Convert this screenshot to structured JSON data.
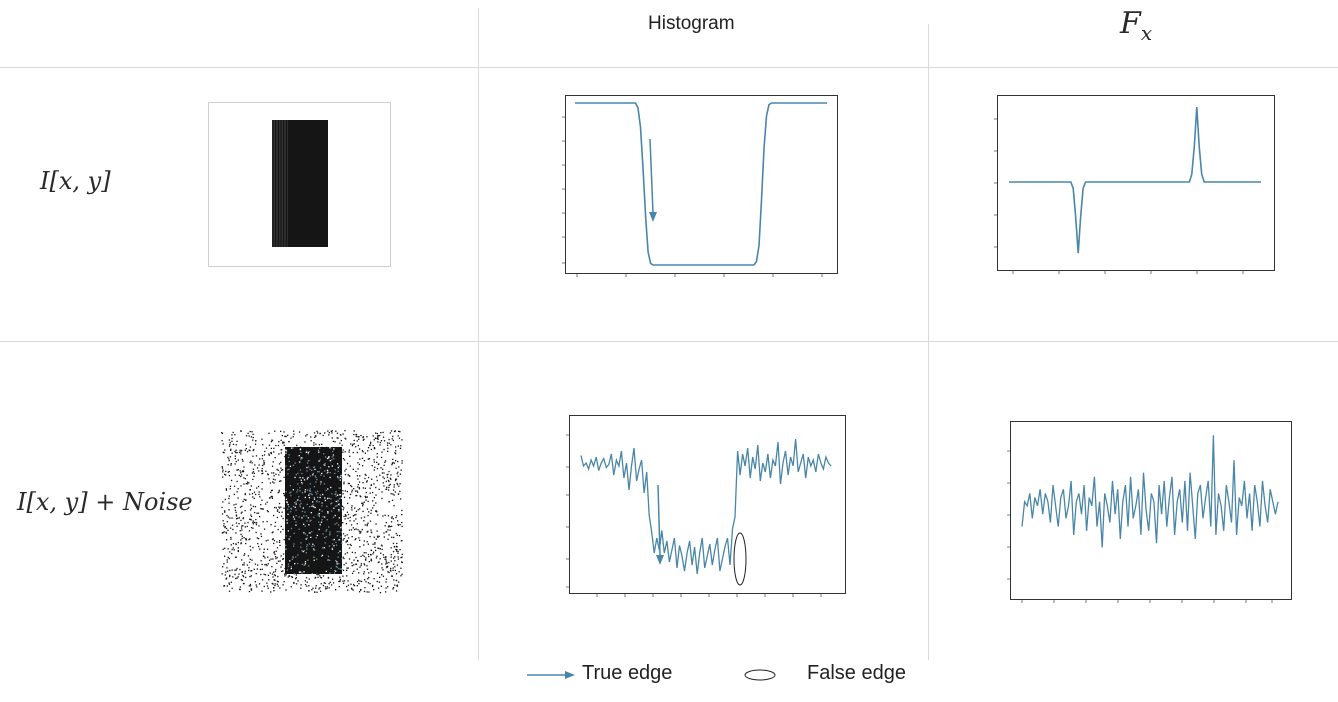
{
  "headers": {
    "histogram": "Histogram",
    "fx_main": "F",
    "fx_sub": "x"
  },
  "rows": [
    {
      "label_main": "I[x, y]",
      "label_suffix": ""
    },
    {
      "label_main": "I[x, y] + ",
      "label_suffix": "Noise"
    }
  ],
  "legend": {
    "true_edge": "True edge",
    "false_edge": "False edge"
  },
  "colors": {
    "line": "#4a86a8",
    "grid_line": "#d9d9d9",
    "axis": "#333333",
    "image_fill": "#151515"
  },
  "chart_data": [
    {
      "type": "line",
      "xlim": [
        0,
        100
      ],
      "ylim": [
        0,
        1
      ],
      "series": [
        {
          "values": [
            1,
            1,
            1,
            1,
            1,
            1,
            1,
            1,
            1,
            1,
            1,
            1,
            1,
            1,
            1,
            1,
            1,
            1,
            1,
            1,
            1,
            1,
            1,
            1,
            1,
            0.97,
            0.85,
            0.6,
            0.3,
            0.08,
            0.01,
            0,
            0,
            0,
            0,
            0,
            0,
            0,
            0,
            0,
            0,
            0,
            0,
            0,
            0,
            0,
            0,
            0,
            0,
            0,
            0,
            0,
            0,
            0,
            0,
            0,
            0,
            0,
            0,
            0,
            0,
            0,
            0,
            0,
            0,
            0,
            0,
            0,
            0,
            0,
            0,
            0,
            0.02,
            0.12,
            0.4,
            0.72,
            0.92,
            0.99,
            1,
            1,
            1,
            1,
            1,
            1,
            1,
            1,
            1,
            1,
            1,
            1,
            1,
            1,
            1,
            1,
            1,
            1,
            1,
            1,
            1,
            1,
            1
          ]
        }
      ]
    },
    {
      "type": "line",
      "xlim": [
        0,
        100
      ],
      "ylim": [
        -1,
        1
      ],
      "series": [
        {
          "values": [
            0,
            0,
            0,
            0,
            0,
            0,
            0,
            0,
            0,
            0,
            0,
            0,
            0,
            0,
            0,
            0,
            0,
            0,
            0,
            0,
            0,
            0,
            0,
            0,
            0,
            0,
            -0.08,
            -0.45,
            -0.9,
            -0.45,
            -0.08,
            0,
            0,
            0,
            0,
            0,
            0,
            0,
            0,
            0,
            0,
            0,
            0,
            0,
            0,
            0,
            0,
            0,
            0,
            0,
            0,
            0,
            0,
            0,
            0,
            0,
            0,
            0,
            0,
            0,
            0,
            0,
            0,
            0,
            0,
            0,
            0,
            0,
            0,
            0,
            0,
            0,
            0,
            0,
            0.1,
            0.45,
            0.95,
            0.45,
            0.1,
            0,
            0,
            0,
            0,
            0,
            0,
            0,
            0,
            0,
            0,
            0,
            0,
            0,
            0,
            0,
            0,
            0,
            0,
            0,
            0,
            0,
            0,
            0,
            0
          ]
        }
      ]
    },
    {
      "type": "line",
      "xlim": [
        0,
        100
      ],
      "ylim": [
        0,
        1
      ],
      "series": [
        {
          "values": [
            0.85,
            0.78,
            0.8,
            0.76,
            0.82,
            0.78,
            0.84,
            0.75,
            0.8,
            0.83,
            0.77,
            0.79,
            0.86,
            0.72,
            0.82,
            0.78,
            0.88,
            0.7,
            0.8,
            0.62,
            0.78,
            0.9,
            0.68,
            0.76,
            0.82,
            0.6,
            0.74,
            0.45,
            0.34,
            0.2,
            0.3,
            0.22,
            0.35,
            0.2,
            0.28,
            0.14,
            0.22,
            0.3,
            0.1,
            0.25,
            0.18,
            0.08,
            0.2,
            0.28,
            0.12,
            0.24,
            0.06,
            0.2,
            0.3,
            0.1,
            0.18,
            0.26,
            0.12,
            0.22,
            0.3,
            0.08,
            0.16,
            0.24,
            0.3,
            0.12,
            0.36,
            0.44,
            0.88,
            0.72,
            0.86,
            0.78,
            0.9,
            0.7,
            0.84,
            0.76,
            0.92,
            0.68,
            0.8,
            0.74,
            0.86,
            0.7,
            0.82,
            0.78,
            0.94,
            0.66,
            0.8,
            0.88,
            0.72,
            0.84,
            0.78,
            0.96,
            0.74,
            0.8,
            0.86,
            0.7,
            0.84,
            0.78,
            0.82,
            0.74,
            0.86,
            0.8,
            0.76,
            0.84,
            0.8,
            0.78
          ]
        }
      ]
    },
    {
      "type": "line",
      "xlim": [
        0,
        100
      ],
      "ylim": [
        -1,
        1
      ],
      "series": [
        {
          "values": [
            -0.2,
            0.1,
            0.05,
            0.2,
            -0.1,
            0.15,
            0.05,
            0.25,
            -0.05,
            0.2,
            0.1,
            -0.15,
            0.3,
            0.05,
            -0.2,
            0.15,
            0.25,
            -0.1,
            0.05,
            0.35,
            -0.3,
            0.1,
            0.2,
            -0.05,
            0.3,
            -0.25,
            0.15,
            0.05,
            0.4,
            -0.2,
            0.1,
            -0.45,
            0.2,
            0.05,
            -0.15,
            0.35,
            -0.05,
            0.25,
            -0.35,
            0.1,
            0.3,
            -0.2,
            0.4,
            -0.1,
            0.05,
            0.25,
            -0.3,
            0.45,
            0,
            -0.25,
            0.2,
            0.1,
            -0.4,
            0.3,
            -0.05,
            0.35,
            -0.2,
            0.15,
            0.4,
            -0.3,
            0.1,
            0.25,
            -0.15,
            0.35,
            -0.25,
            0.45,
            0.05,
            -0.35,
            0.2,
            0.3,
            -0.1,
            0.15,
            0.35,
            -0.2,
            0.9,
            -0.3,
            0.2,
            0.05,
            -0.25,
            0.3,
            0.1,
            -0.15,
            0.6,
            -0.3,
            0.15,
            0.05,
            0.35,
            -0.1,
            0.2,
            -0.25,
            0.3,
            0.1,
            -0.2,
            0.35,
            0.05,
            -0.15,
            0.25,
            0.1,
            -0.05,
            0.1
          ]
        }
      ]
    }
  ]
}
